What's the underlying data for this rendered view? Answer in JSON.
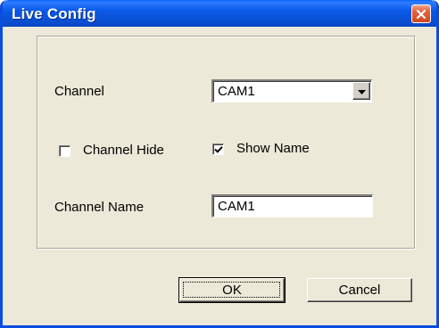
{
  "window": {
    "title": "Live Config",
    "close_icon": "close-icon"
  },
  "form": {
    "channel_label": "Channel",
    "channel_value": "CAM1",
    "channel_hide_label": "Channel Hide",
    "channel_hide_checked": false,
    "show_name_label": "Show Name",
    "show_name_checked": true,
    "channel_name_label": "Channel Name",
    "channel_name_value": "CAM1"
  },
  "buttons": {
    "ok_label": "OK",
    "cancel_label": "Cancel"
  },
  "colors": {
    "titlebar": "#0a59e8",
    "dialog_bg": "#ece9d8",
    "close_button": "#d4461d"
  }
}
